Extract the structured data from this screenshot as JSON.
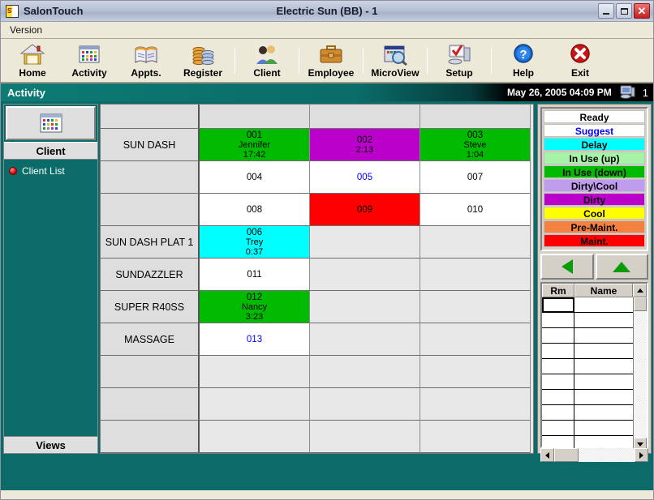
{
  "window": {
    "app_name": "SalonTouch",
    "title": "Electric Sun (BB) - 1",
    "minimize_label": "Minimize",
    "maximize_label": "Maximize",
    "close_label": "Close"
  },
  "menubar": {
    "items": [
      "Version"
    ]
  },
  "toolbar": {
    "buttons": [
      {
        "label": "Home",
        "icon": "home-icon"
      },
      {
        "label": "Activity",
        "icon": "calendar-icon"
      },
      {
        "label": "Appts.",
        "icon": "book-icon"
      },
      {
        "label": "Register",
        "icon": "coins-icon"
      },
      {
        "label": "Client",
        "icon": "people-icon"
      },
      {
        "label": "Employee",
        "icon": "briefcase-icon"
      },
      {
        "label": "MicroView",
        "icon": "magnifier-screen-icon"
      },
      {
        "label": "Setup",
        "icon": "computer-check-icon"
      },
      {
        "label": "Help",
        "icon": "question-circle-icon"
      },
      {
        "label": "Exit",
        "icon": "red-x-icon"
      }
    ]
  },
  "activity_band": {
    "title": "Activity",
    "datetime": "May 26, 2005 04:09 PM",
    "station_number": "1",
    "station_icon": "computer-icon"
  },
  "sidebar": {
    "icon": "calendar-icon",
    "header": "Client",
    "items": [
      {
        "label": "Client List",
        "bullet": "red-bullet-icon"
      }
    ],
    "footer": "Views"
  },
  "grid": {
    "header_row": [
      "",
      "",
      "",
      ""
    ],
    "rows": [
      {
        "name": "SUN DASH",
        "cells": [
          {
            "id": "001",
            "client": "Jennifer",
            "time": "17:42",
            "bg": "#00BB00",
            "fg": "#000000"
          },
          {
            "id": "002",
            "client": "",
            "time": "2:13",
            "bg": "#BB00CC",
            "fg": "#000000"
          },
          {
            "id": "003",
            "client": "Steve",
            "time": "1:04",
            "bg": "#00BB00",
            "fg": "#000000"
          }
        ]
      },
      {
        "name": "",
        "cells": [
          {
            "id": "004",
            "client": "",
            "time": "",
            "bg": "#FFFFFF",
            "fg": "#000000"
          },
          {
            "id": "005",
            "client": "",
            "time": "",
            "bg": "#FFFFFF",
            "fg": "#0000FF"
          },
          {
            "id": "007",
            "client": "",
            "time": "",
            "bg": "#FFFFFF",
            "fg": "#000000"
          }
        ]
      },
      {
        "name": "",
        "cells": [
          {
            "id": "008",
            "client": "",
            "time": "",
            "bg": "#FFFFFF",
            "fg": "#000000"
          },
          {
            "id": "009",
            "client": "",
            "time": "",
            "bg": "#FF0000",
            "fg": "#000000"
          },
          {
            "id": "010",
            "client": "",
            "time": "",
            "bg": "#FFFFFF",
            "fg": "#000000"
          }
        ]
      },
      {
        "name": "SUN DASH PLAT 1",
        "cells": [
          {
            "id": "006",
            "client": "Trey",
            "time": "0:37",
            "bg": "#00FFFF",
            "fg": "#000000"
          },
          {
            "id": "",
            "client": "",
            "time": "",
            "bg": "#E8E8E8",
            "fg": "#000000"
          },
          {
            "id": "",
            "client": "",
            "time": "",
            "bg": "#E8E8E8",
            "fg": "#000000"
          }
        ]
      },
      {
        "name": "SUNDAZZLER",
        "cells": [
          {
            "id": "011",
            "client": "",
            "time": "",
            "bg": "#FFFFFF",
            "fg": "#000000"
          },
          {
            "id": "",
            "client": "",
            "time": "",
            "bg": "#E8E8E8",
            "fg": "#000000"
          },
          {
            "id": "",
            "client": "",
            "time": "",
            "bg": "#E8E8E8",
            "fg": "#000000"
          }
        ]
      },
      {
        "name": "SUPER R40SS",
        "cells": [
          {
            "id": "012",
            "client": "Nancy",
            "time": "3:23",
            "bg": "#00BB00",
            "fg": "#000000"
          },
          {
            "id": "",
            "client": "",
            "time": "",
            "bg": "#E8E8E8",
            "fg": "#000000"
          },
          {
            "id": "",
            "client": "",
            "time": "",
            "bg": "#E8E8E8",
            "fg": "#000000"
          }
        ]
      },
      {
        "name": "MASSAGE",
        "cells": [
          {
            "id": "013",
            "client": "",
            "time": "",
            "bg": "#FFFFFF",
            "fg": "#0000FF"
          },
          {
            "id": "",
            "client": "",
            "time": "",
            "bg": "#E8E8E8",
            "fg": "#000000"
          },
          {
            "id": "",
            "client": "",
            "time": "",
            "bg": "#E8E8E8",
            "fg": "#000000"
          }
        ]
      },
      {
        "name": "",
        "cells": [
          {
            "id": "",
            "client": "",
            "time": "",
            "bg": "#E8E8E8",
            "fg": "#000000"
          },
          {
            "id": "",
            "client": "",
            "time": "",
            "bg": "#E8E8E8",
            "fg": "#000000"
          },
          {
            "id": "",
            "client": "",
            "time": "",
            "bg": "#E8E8E8",
            "fg": "#000000"
          }
        ]
      },
      {
        "name": "",
        "cells": [
          {
            "id": "",
            "client": "",
            "time": "",
            "bg": "#E8E8E8",
            "fg": "#000000"
          },
          {
            "id": "",
            "client": "",
            "time": "",
            "bg": "#E8E8E8",
            "fg": "#000000"
          },
          {
            "id": "",
            "client": "",
            "time": "",
            "bg": "#E8E8E8",
            "fg": "#000000"
          }
        ]
      },
      {
        "name": "",
        "cells": [
          {
            "id": "",
            "client": "",
            "time": "",
            "bg": "#E8E8E8",
            "fg": "#000000"
          },
          {
            "id": "",
            "client": "",
            "time": "",
            "bg": "#E8E8E8",
            "fg": "#000000"
          },
          {
            "id": "",
            "client": "",
            "time": "",
            "bg": "#E8E8E8",
            "fg": "#000000"
          }
        ]
      }
    ]
  },
  "legend": {
    "entries": [
      {
        "label": "Ready",
        "bg": "#FFFFFF",
        "fg": "#000000"
      },
      {
        "label": "Suggest",
        "bg": "#FFFFFF",
        "fg": "#0000FF"
      },
      {
        "label": "Delay",
        "bg": "#00FFFF",
        "fg": "#000000"
      },
      {
        "label": "In Use (up)",
        "bg": "#A6F2A6",
        "fg": "#000000"
      },
      {
        "label": "In Use (down)",
        "bg": "#00BB00",
        "fg": "#000000"
      },
      {
        "label": "Dirty\\Cool",
        "bg": "#C09CEE",
        "fg": "#000000"
      },
      {
        "label": "Dirty",
        "bg": "#BB00CC",
        "fg": "#000000"
      },
      {
        "label": "Cool",
        "bg": "#FFFF00",
        "fg": "#000000"
      },
      {
        "label": "Pre-Maint.",
        "bg": "#F4813F",
        "fg": "#000000"
      },
      {
        "label": "Maint.",
        "bg": "#FF0000",
        "fg": "#000000"
      }
    ]
  },
  "nav": {
    "back_icon": "green-left-triangle-icon",
    "up_icon": "green-up-triangle-icon"
  },
  "rm_table": {
    "columns": [
      "Rm",
      "Name"
    ],
    "rows": [
      {
        "rm": "",
        "name": ""
      },
      {
        "rm": "",
        "name": ""
      },
      {
        "rm": "",
        "name": ""
      },
      {
        "rm": "",
        "name": ""
      },
      {
        "rm": "",
        "name": ""
      },
      {
        "rm": "",
        "name": ""
      },
      {
        "rm": "",
        "name": ""
      },
      {
        "rm": "",
        "name": ""
      },
      {
        "rm": "",
        "name": ""
      },
      {
        "rm": "",
        "name": ""
      }
    ]
  }
}
